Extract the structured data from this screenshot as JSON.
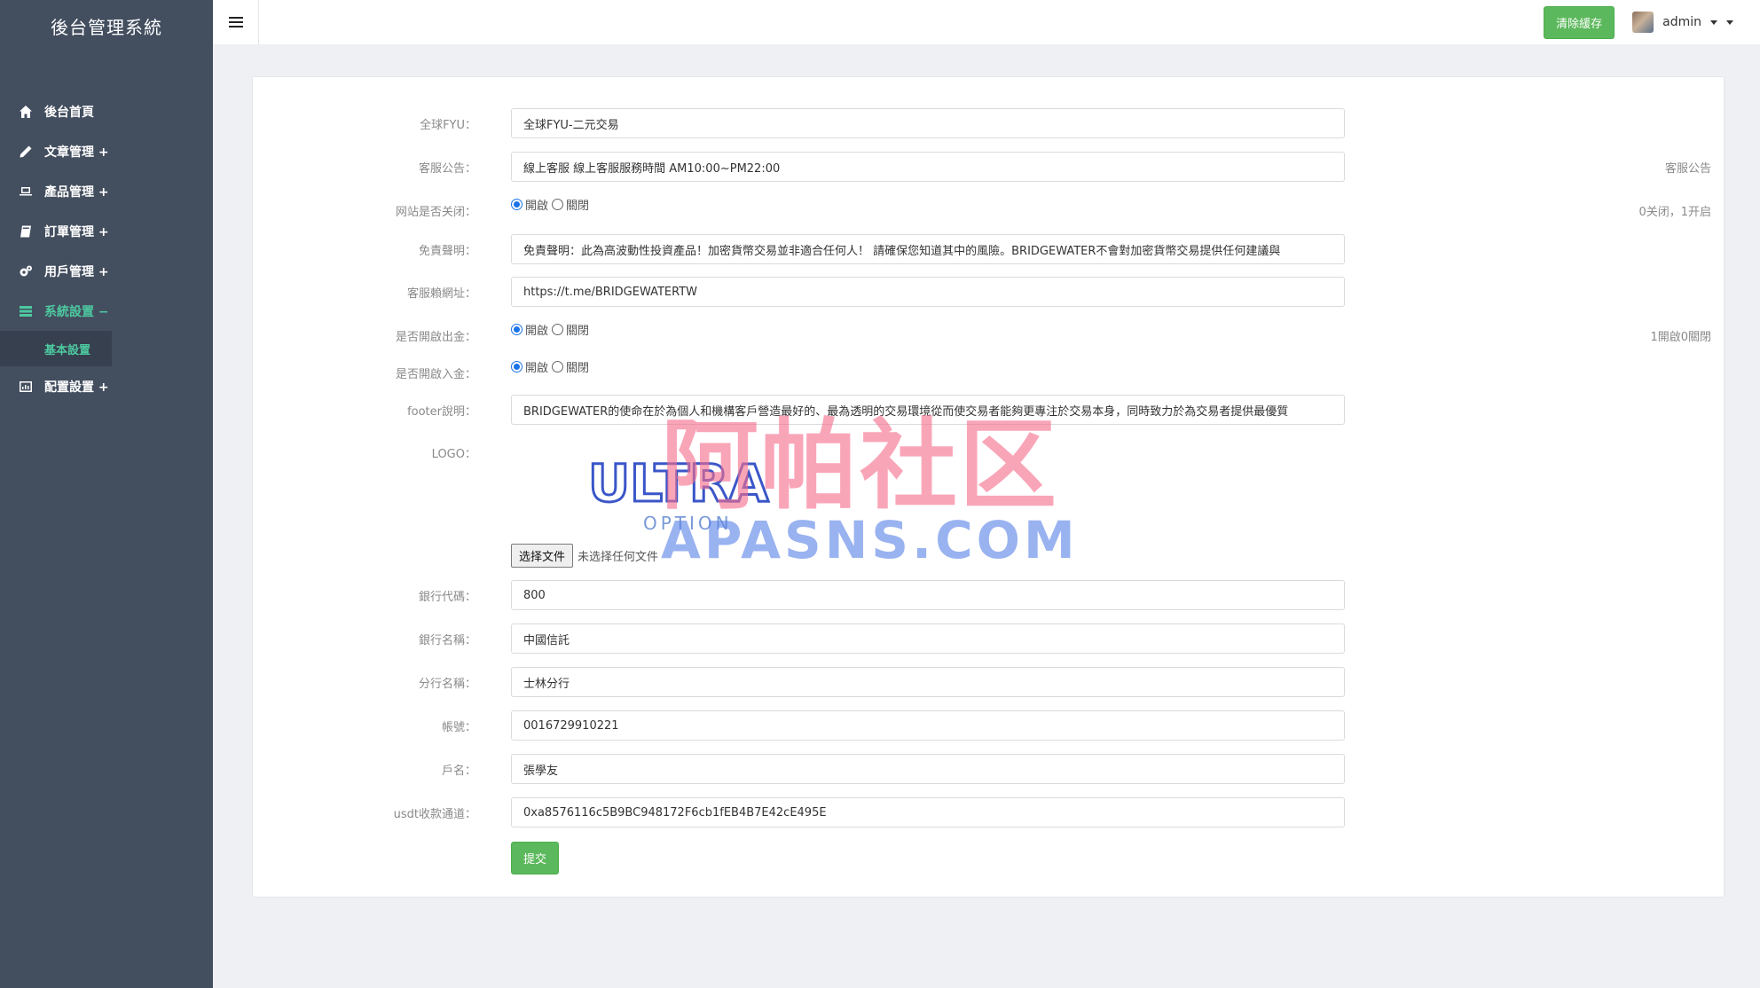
{
  "brand": "後台管理系統",
  "sidebar": {
    "items": [
      {
        "label": "後台首頁",
        "icon": "home-icon"
      },
      {
        "label": "文章管理 +",
        "icon": "pencil-icon"
      },
      {
        "label": "產品管理 +",
        "icon": "laptop-icon"
      },
      {
        "label": "訂單管理 +",
        "icon": "book-icon"
      },
      {
        "label": "用戶管理 +",
        "icon": "gears-icon"
      },
      {
        "label": "系統設置 −",
        "icon": "server-icon",
        "active": true
      },
      {
        "label": "配置設置 +",
        "icon": "chart-icon"
      }
    ],
    "sub_item": "基本設置"
  },
  "topbar": {
    "clear_cache": "清除緩存",
    "user": "admin"
  },
  "form": {
    "title_label": "全球FYU：",
    "title_value": "全球FYU-二元交易",
    "notice_label": "客服公告：",
    "notice_value": "線上客服 線上客服服務時間 AM10:00~PM22:00",
    "notice_hint": "客服公告",
    "site_closed_label": "网站是否关闭：",
    "open_text": "開啟",
    "close_text": "關閉",
    "site_closed_hint": "0关闭，1开启",
    "disclaimer_label": "免責聲明：",
    "disclaimer_value": "免責聲明：此為高波動性投資產品！加密貨幣交易並非適合任何人！ 請確保您知道其中的風險。BRIDGEWATER不會對加密貨幣交易提供任何建議與",
    "cs_url_label": "客服賴網址：",
    "cs_url_value": "https://t.me/BRIDGEWATERTW",
    "withdraw_label": "是否開啟出金：",
    "withdraw_hint": "1開啟0關閉",
    "deposit_label": "是否開啟入金：",
    "footer_label": "footer說明：",
    "footer_value": "BRIDGEWATER的使命在於為個人和機構客戶營造最好的、最為透明的交易環境從而使交易者能夠更專注於交易本身，同時致力於為交易者提供最優質",
    "logo_label": "LOGO：",
    "logo_text_main": "ULTRA",
    "logo_text_sub": "OPTION",
    "file_button": "选择文件",
    "file_status": "未选择任何文件",
    "bank_code_label": "銀行代碼：",
    "bank_code_value": "800",
    "bank_name_label": "銀行名稱：",
    "bank_name_value": "中國信託",
    "branch_label": "分行名稱：",
    "branch_value": "士林分行",
    "account_label": "帳號：",
    "account_value": "0016729910221",
    "holder_label": "戶名：",
    "holder_value": "張學友",
    "usdt_label": "usdt收款通道：",
    "usdt_value": "0xa8576116c5B9BC948172F6cb1fEB4B7E42cE495E",
    "submit": "提交"
  },
  "watermark": {
    "cn": "阿帕社区",
    "en": "APASNS.COM"
  },
  "colors": {
    "sidebar_bg": "#434e5f",
    "accent": "#4dc9a0",
    "button_green": "#5cb85c"
  }
}
